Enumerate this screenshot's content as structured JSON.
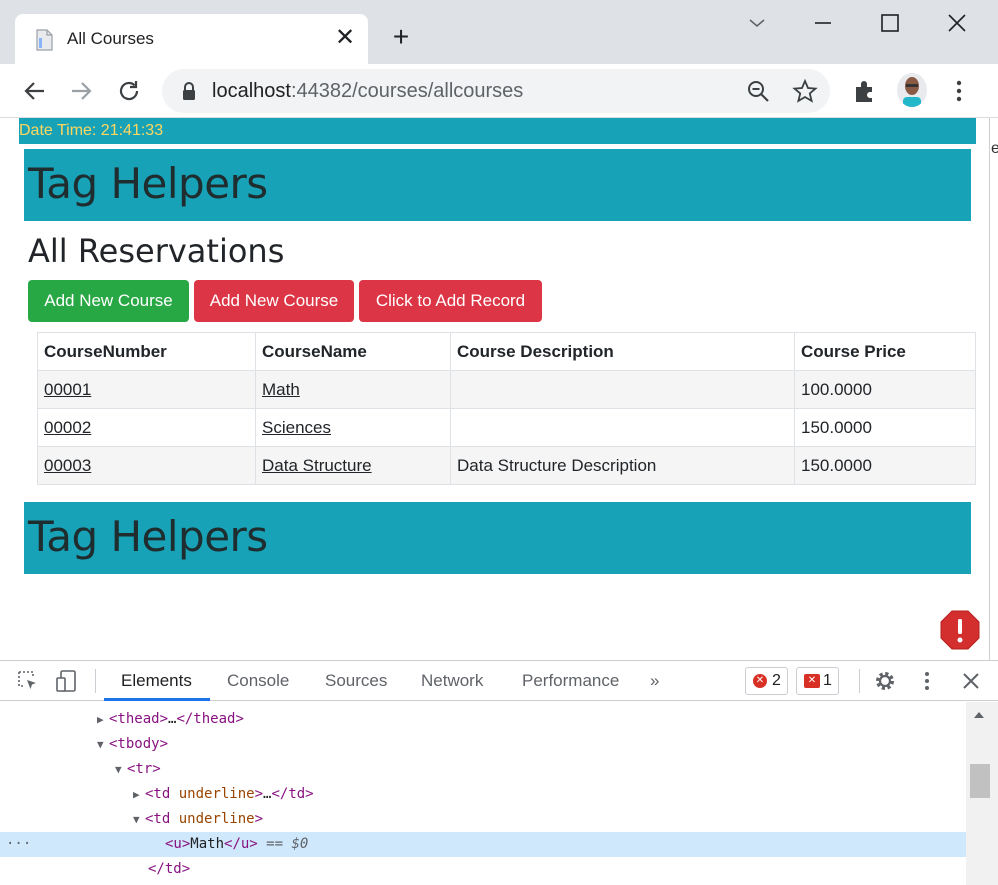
{
  "browser": {
    "tab_title": "All Courses",
    "url_host": "localhost",
    "url_path": ":44382/courses/allcourses",
    "edge_letter": "e"
  },
  "page": {
    "datetime": "Date Time: 21:41:33",
    "hero_title": "Tag Helpers",
    "heading": "All Reservations",
    "buttons": [
      {
        "label": "Add New Course",
        "color": "#28a745"
      },
      {
        "label": "Add New Course",
        "color": "#dc3545"
      },
      {
        "label": "Click to Add Record",
        "color": "#dc3545"
      }
    ],
    "table": {
      "headers": [
        "CourseNumber",
        "CourseName",
        "Course Description",
        "Course Price"
      ],
      "rows": [
        [
          "00001",
          "Math",
          "",
          "100.0000"
        ],
        [
          "00002",
          "Sciences",
          "",
          "150.0000"
        ],
        [
          "00003",
          "Data Structure",
          "Data Structure Description",
          "150.0000"
        ]
      ]
    },
    "footer_title": "Tag Helpers"
  },
  "devtools": {
    "tabs": [
      "Elements",
      "Console",
      "Sources",
      "Network",
      "Performance"
    ],
    "more": "»",
    "error_count": "2",
    "issue_count": "1",
    "dom": {
      "thead_open": "<thead>",
      "thead_ellipsis": "…",
      "thead_close": "</thead>",
      "tbody": "<tbody>",
      "tr": "<tr>",
      "td_open": "<td",
      "td_attr": " underline",
      "td_end": ">",
      "td_ellipsis": "…",
      "td_close": "</td>",
      "u_open": "<u>",
      "u_text": "Math",
      "u_close": "</u>",
      "selected_marker": " == $0",
      "row_dots": "···"
    }
  },
  "colors": {
    "teal": "#17a2b8",
    "datetime_text": "#ffd75e",
    "success": "#28a745",
    "danger": "#dc3545",
    "devtools_accent": "#1a73e8"
  }
}
